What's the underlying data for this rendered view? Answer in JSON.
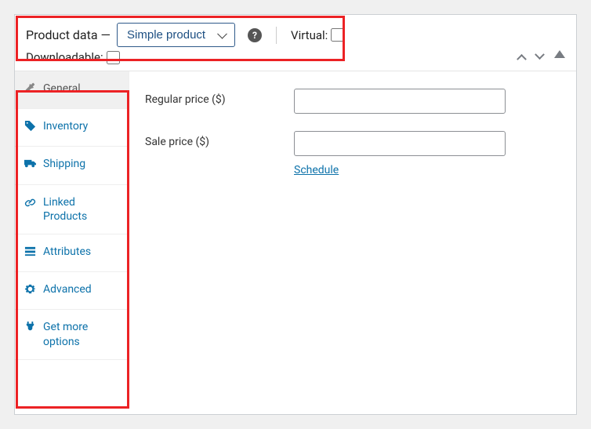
{
  "header": {
    "title_prefix": "Product data —",
    "product_type": "Simple product",
    "virtual_label": "Virtual:",
    "downloadable_label": "Downloadable:",
    "help_glyph": "?"
  },
  "tabs": [
    {
      "label": "General",
      "active": true
    },
    {
      "label": "Inventory",
      "active": false
    },
    {
      "label": "Shipping",
      "active": false
    },
    {
      "label": "Linked Products",
      "active": false
    },
    {
      "label": "Attributes",
      "active": false
    },
    {
      "label": "Advanced",
      "active": false
    },
    {
      "label": "Get more options",
      "active": false
    }
  ],
  "fields": {
    "regular_price_label": "Regular price ($)",
    "regular_price_value": "",
    "sale_price_label": "Sale price ($)",
    "sale_price_value": "",
    "schedule_label": "Schedule"
  }
}
